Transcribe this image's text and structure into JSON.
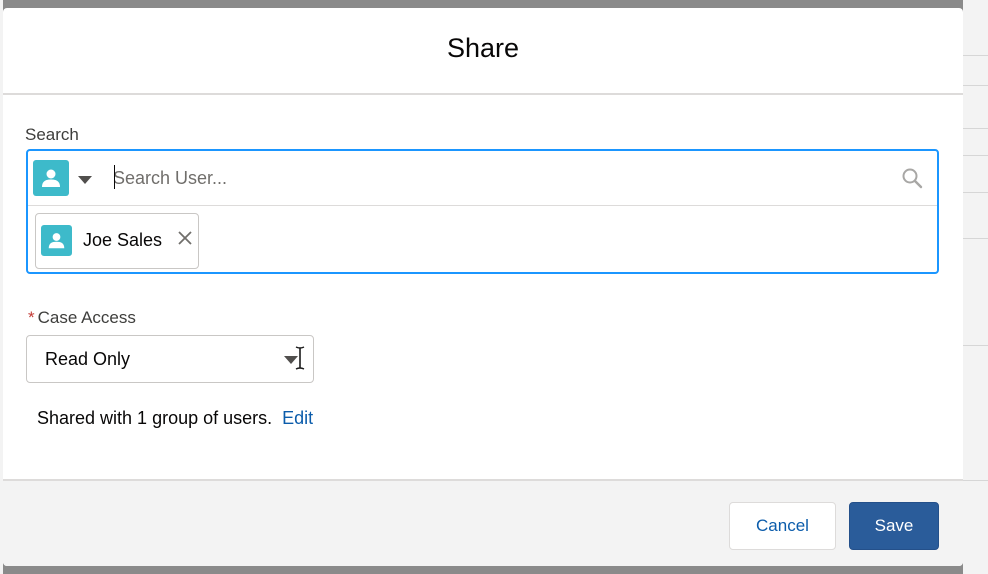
{
  "modal": {
    "title": "Share"
  },
  "search": {
    "label": "Search",
    "placeholder": "Search User...",
    "type_icon": "user-icon",
    "selected": [
      {
        "label": "Joe Sales",
        "icon": "user-icon"
      }
    ]
  },
  "case_access": {
    "required_mark": "*",
    "label": "Case Access",
    "selected": "Read Only"
  },
  "sharing": {
    "summary": "Shared with 1 group of users.",
    "edit_label": "Edit"
  },
  "footer": {
    "cancel_label": "Cancel",
    "save_label": "Save"
  },
  "colors": {
    "focus_border": "#1b96ff",
    "user_icon_bg": "#3dbaca",
    "link": "#0b5cab",
    "brand_button": "#2a5c9a",
    "required": "#c23934"
  }
}
